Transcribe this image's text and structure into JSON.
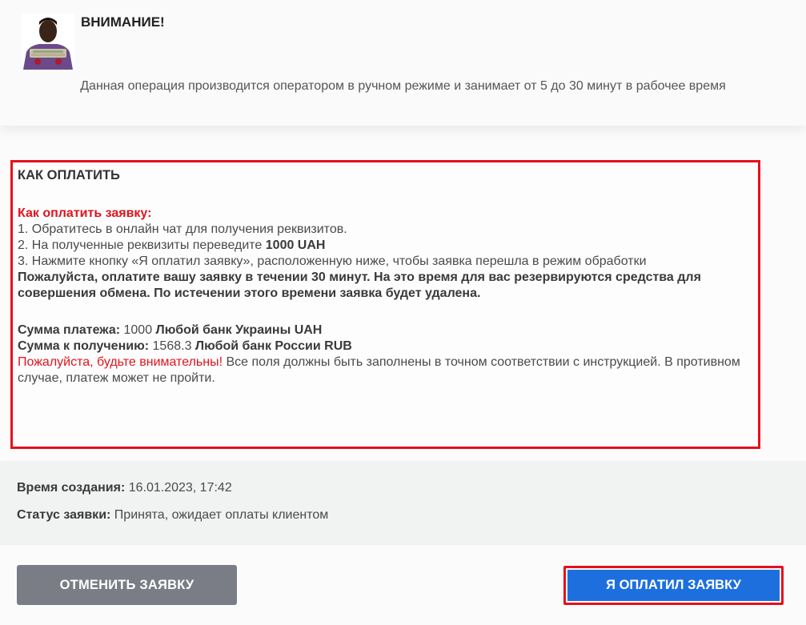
{
  "notice": {
    "title": "ВНИМАНИЕ!",
    "text": "Данная операция производится оператором в ручном режиме и занимает от 5 до 30 минут в рабочее время"
  },
  "instructions": {
    "heading": "КАК ОПЛАТИТЬ",
    "subheading": "Как оплатить заявку:",
    "step1": "1. Обратитесь в онлайн чат для получения реквизитов.",
    "step2_prefix": "2. На полученные реквизиты переведите ",
    "step2_amount": "1000 UAH",
    "step3": "3. Нажмите кнопку «Я оплатил заявку», расположенную ниже, чтобы заявка перешла в режим обработки",
    "warning": "Пожалуйста, оплатите вашу заявку в течении 30 минут. На это время для вас резервируются средства для совершения обмена. По истечении этого времени заявка будет удалена.",
    "payment_label": "Сумма платежа:",
    "payment_value": " 1000 ",
    "payment_bank": "Любой банк Украины UAH",
    "receive_label": "Сумма к получению:",
    "receive_value": " 1568.3 ",
    "receive_bank": "Любой банк России RUB",
    "attention_red": "Пожалуйста, будьте внимательны!",
    "attention_text": " Все поля должны быть заполнены в точном соответствии с инструкцией. В противном случае, платеж может не пройти."
  },
  "info": {
    "created_label": "Время создания:",
    "created_value": " 16.01.2023, 17:42",
    "status_label": "Статус заявки:",
    "status_value": " Принята, ожидает оплаты клиентом"
  },
  "buttons": {
    "cancel": "ОТМЕНИТЬ ЗАЯВКУ",
    "paid": "Я ОПЛАТИЛ ЗАЯВКУ"
  },
  "colors": {
    "accent_red": "#e8101b",
    "primary_blue": "#1e6fde",
    "cancel_gray": "#7a7d86"
  }
}
